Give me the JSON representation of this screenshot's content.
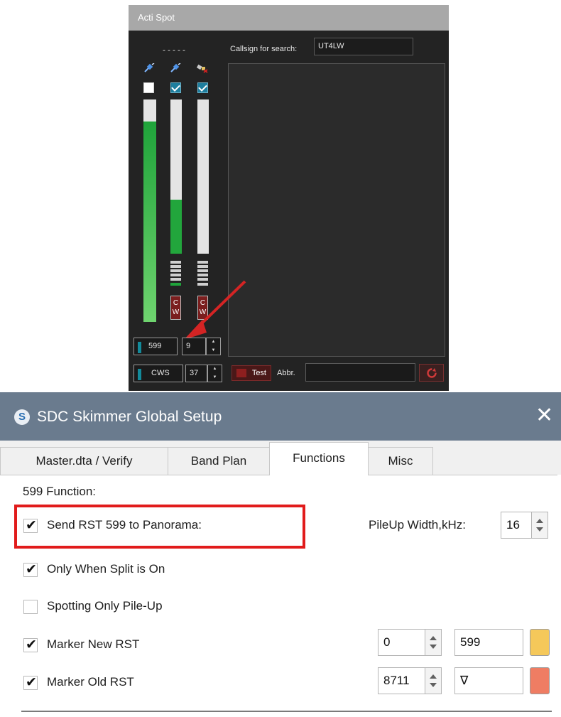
{
  "acti_spot": {
    "title": "Acti Spot",
    "dashes": "-----",
    "search_label": "Callsign for search:",
    "search_value": "UT4LW",
    "receivers": [
      {
        "checked": false,
        "icon": "plug-connected-icon",
        "level": 0.9
      },
      {
        "checked": true,
        "icon": "plug-connected-icon",
        "level": 0.35
      },
      {
        "checked": true,
        "icon": "plug-disconnected-icon",
        "level": 0.0
      }
    ],
    "cw_badge_top": "C",
    "cw_badge_bottom": "W",
    "rst_value": "599",
    "rst_spin_value": "9",
    "cws_label": "CWS",
    "cws_spin_value": "37",
    "test_button": "Test",
    "abbr_label": "Abbr.",
    "abbr_value": ""
  },
  "setup": {
    "title": "SDC Skimmer Global Setup",
    "close_label": "✕",
    "logo_letter": "S",
    "tabs": [
      "Master.dta / Verify",
      "Band Plan",
      "Functions",
      "Misc"
    ],
    "active_tab": "Functions",
    "section_label": "599 Function:",
    "options": [
      {
        "label": "Send RST 599 to Panorama:",
        "checked": true
      },
      {
        "label": "Only When Split is On",
        "checked": true
      },
      {
        "label": "Spotting Only Pile-Up",
        "checked": false
      },
      {
        "label": "Marker New RST",
        "checked": true
      },
      {
        "label": "Marker Old RST",
        "checked": true
      }
    ],
    "pileup_label": "PileUp Width,kHz:",
    "pileup_value": "16",
    "marker_new_num": "0",
    "marker_new_text": "599",
    "marker_new_color": "#f5c85a",
    "marker_old_num": "8711",
    "marker_old_text": "∇",
    "marker_old_color": "#ef7d63",
    "check_glyph": "✔"
  }
}
